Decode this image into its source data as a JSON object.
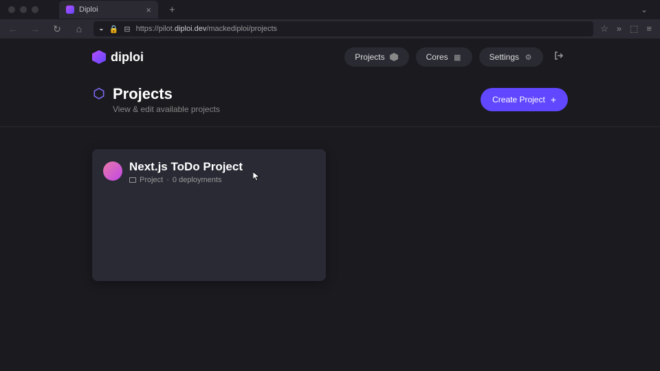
{
  "browser": {
    "tab_title": "Diploi",
    "url_prefix": "https://pilot.",
    "url_domain": "diploi.dev",
    "url_path": "/mackediploi/projects"
  },
  "nav": {
    "logo_text": "diploi",
    "projects": "Projects",
    "cores": "Cores",
    "settings": "Settings"
  },
  "header": {
    "title": "Projects",
    "subtitle": "View & edit available projects",
    "create_btn": "Create Project"
  },
  "project": {
    "name": "Next.js ToDo Project",
    "type": "Project",
    "deployments": "0 deployments"
  },
  "colors": {
    "accent": "#6147ff",
    "card_bg": "#2a2a35"
  }
}
